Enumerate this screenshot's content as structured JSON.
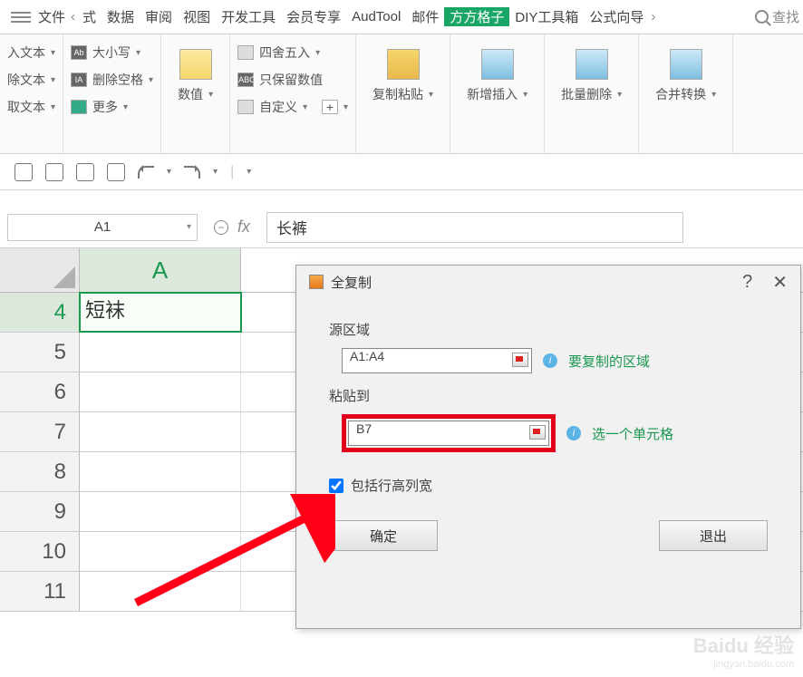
{
  "menubar": {
    "file": "文件",
    "tabs": [
      "式",
      "数据",
      "审阅",
      "视图",
      "开发工具",
      "会员专享",
      "AudTool",
      "邮件",
      "方方格子",
      "DIY工具箱",
      "公式向导"
    ],
    "active_index": 8,
    "search": "查找"
  },
  "ribbon": {
    "g1": {
      "r1": "入文本",
      "r2": "除文本",
      "r3": "取文本"
    },
    "g2": {
      "r1": "大小写",
      "r2": "删除空格",
      "r3": "更多",
      "ab": "Ab",
      "aa": "IA"
    },
    "g3": {
      "label": "数值"
    },
    "g4": {
      "r1": "四舍五入",
      "r2": "只保留数值",
      "r3": "自定义",
      "abc": "ABC",
      "plus": "+"
    },
    "g5": {
      "label": "复制粘贴"
    },
    "g6": {
      "label": "新增插入"
    },
    "g7": {
      "label": "批量删除"
    },
    "g8": {
      "label": "合并转换"
    }
  },
  "fbar": {
    "cell_ref": "A1",
    "fx": "fx",
    "value": "长裤"
  },
  "sheet": {
    "col": "A",
    "rows": [
      "4",
      "5",
      "6",
      "7",
      "8",
      "9",
      "10",
      "11"
    ],
    "cell_a4": "短袜"
  },
  "dialog": {
    "title": "全复制",
    "source_label": "源区域",
    "source_value": "A1:A4",
    "source_hint": "要复制的区域",
    "dest_label": "粘贴到",
    "dest_value": "B7",
    "dest_hint": "选一个单元格",
    "checkbox_label": "包括行高列宽",
    "ok": "确定",
    "cancel": "退出",
    "help": "?",
    "close": "✕"
  },
  "watermark": {
    "main": "Baidu 经验",
    "sub": "jingyan.baidu.com"
  }
}
